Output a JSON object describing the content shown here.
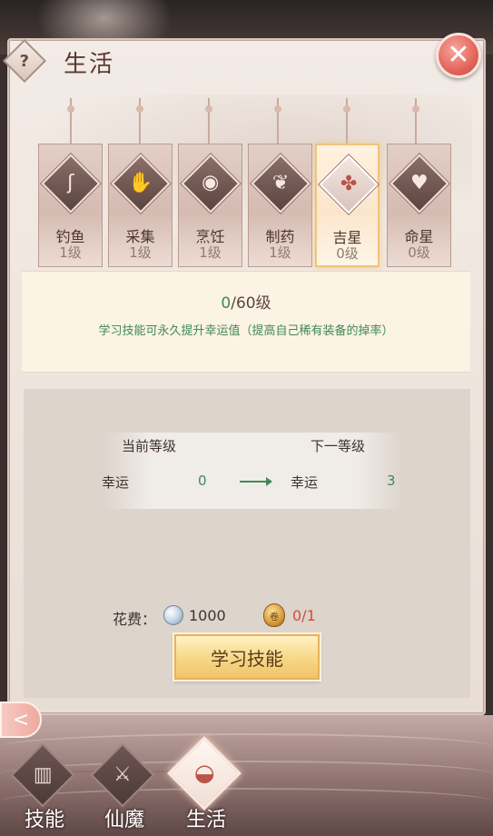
{
  "header": {
    "help_label": "?",
    "title": "生活",
    "close_label": "✕"
  },
  "skills": [
    {
      "name": "钓鱼",
      "level": "1级",
      "icon": "fishing-hook-icon",
      "glyph": "ʃ",
      "active": false
    },
    {
      "name": "采集",
      "level": "1级",
      "icon": "gather-hand-icon",
      "glyph": "✋",
      "active": false
    },
    {
      "name": "烹饪",
      "level": "1级",
      "icon": "cooking-pan-icon",
      "glyph": "◉",
      "active": false
    },
    {
      "name": "制药",
      "level": "1级",
      "icon": "herb-bowl-icon",
      "glyph": "❦",
      "active": false
    },
    {
      "name": "吉星",
      "level": "0级",
      "icon": "lucky-star-icon",
      "glyph": "✤",
      "active": true
    },
    {
      "name": "命星",
      "level": "0级",
      "icon": "destiny-star-icon",
      "glyph": "♥",
      "active": false
    }
  ],
  "info": {
    "progress_current": "0",
    "progress_max": "/60级",
    "description": "学习技能可永久提升幸运值（提高自己稀有装备的掉率）"
  },
  "compare": {
    "current_header": "当前等级",
    "next_header": "下一等级",
    "current_stat": "幸运",
    "current_value": "0",
    "next_stat": "幸运",
    "next_value": "3"
  },
  "cost": {
    "label": "花费：",
    "coin_value": "1000",
    "token_text": "卷",
    "token_value": "0/1"
  },
  "learn_button": "学习技能",
  "back_button": "<",
  "bottom_nav": [
    {
      "label": "技能",
      "icon": "skill-book-icon",
      "glyph": "▥",
      "active": false
    },
    {
      "label": "仙魔",
      "icon": "sword-wing-icon",
      "glyph": "⚔",
      "active": false
    },
    {
      "label": "生活",
      "icon": "cooking-bowl-icon",
      "glyph": "◒",
      "active": true
    }
  ],
  "colors": {
    "accent_green": "#3f8a55",
    "warn_red": "#d44a3a",
    "gold": "#f0c46a"
  }
}
